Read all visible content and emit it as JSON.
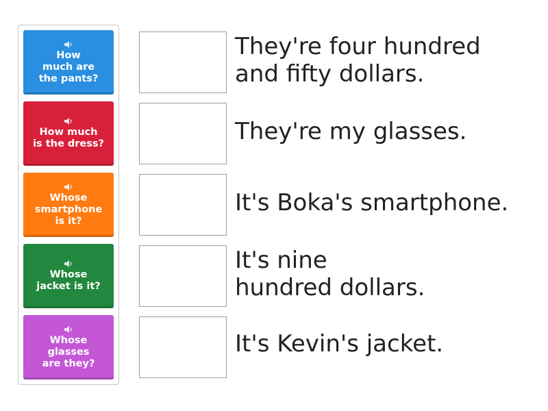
{
  "colors": {
    "card_blue": "#2a8fe0",
    "card_red": "#d9203a",
    "card_orange": "#ff7a10",
    "card_green": "#23883f",
    "card_purple": "#c357d6"
  },
  "cards": [
    {
      "label": "How\nmuch are\nthe pants?",
      "color": "#2a8fe0",
      "icon": "speaker-icon"
    },
    {
      "label": "How much\nis the dress?",
      "color": "#d9203a",
      "icon": "speaker-icon"
    },
    {
      "label": "Whose\nsmartphone\nis it?",
      "color": "#ff7a10",
      "icon": "speaker-icon"
    },
    {
      "label": "Whose\njacket is it?",
      "color": "#23883f",
      "icon": "speaker-icon"
    },
    {
      "label": "Whose\nglasses\nare they?",
      "color": "#c357d6",
      "icon": "speaker-icon"
    }
  ],
  "answers": [
    "They're four hundred\nand fifty dollars.",
    "They're my glasses.",
    "It's Boka's smartphone.",
    "It's nine\nhundred dollars.",
    "It's Kevin's jacket."
  ]
}
